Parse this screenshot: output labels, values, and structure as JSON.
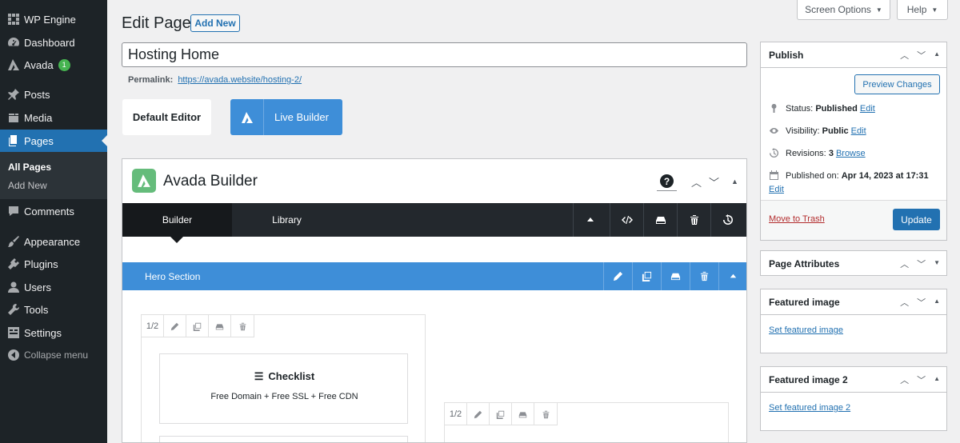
{
  "admin_menu": {
    "items": [
      {
        "label": "WP Engine",
        "icon": "wp-engine-icon"
      },
      {
        "label": "Dashboard",
        "icon": "dashboard-icon"
      },
      {
        "label": "Avada",
        "icon": "avada-icon",
        "badge": "1"
      },
      {
        "label": "Posts",
        "icon": "pin-icon"
      },
      {
        "label": "Media",
        "icon": "media-icon"
      },
      {
        "label": "Pages",
        "icon": "pages-icon",
        "current": true
      },
      {
        "label": "Comments",
        "icon": "comment-icon"
      },
      {
        "label": "Appearance",
        "icon": "brush-icon"
      },
      {
        "label": "Plugins",
        "icon": "plugin-icon"
      },
      {
        "label": "Users",
        "icon": "users-icon"
      },
      {
        "label": "Tools",
        "icon": "wrench-icon"
      },
      {
        "label": "Settings",
        "icon": "settings-icon"
      }
    ],
    "submenu": [
      "All Pages",
      "Add New"
    ],
    "collapse_label": "Collapse menu"
  },
  "top_bar": {
    "screen_options": "Screen Options",
    "help": "Help"
  },
  "page": {
    "heading": "Edit Page",
    "add_new": "Add New",
    "title_value": "Hosting Home",
    "permalink_label": "Permalink:",
    "permalink_url": "https://avada.website/hosting-2/",
    "default_editor": "Default Editor",
    "live_builder": "Live Builder"
  },
  "builder": {
    "title": "Avada Builder",
    "tabs": [
      "Builder",
      "Library"
    ],
    "section_label": "Hero Section",
    "column_size_left": "1/2",
    "column_size_right": "1/2",
    "checklist_title": "Checklist",
    "checklist_text": "Free Domain + Free SSL + Free CDN"
  },
  "publish": {
    "title": "Publish",
    "preview_button": "Preview Changes",
    "status_label": "Status:",
    "status_value": "Published",
    "visibility_label": "Visibility:",
    "visibility_value": "Public",
    "revisions_label": "Revisions:",
    "revisions_value": "3",
    "browse": "Browse",
    "edit": "Edit",
    "published_label": "Published on:",
    "published_value": "Apr 14, 2023 at 17:31",
    "trash": "Move to Trash",
    "update": "Update"
  },
  "page_attributes": {
    "title": "Page Attributes"
  },
  "featured_image": {
    "title": "Featured image",
    "link": "Set featured image"
  },
  "featured_image_2": {
    "title": "Featured image 2",
    "link": "Set featured image 2"
  },
  "colors": {
    "sidebar": "#1d2327",
    "accent": "#2271b1",
    "builder_blue": "#3e8ed8",
    "avada_green": "#65bc7b"
  }
}
